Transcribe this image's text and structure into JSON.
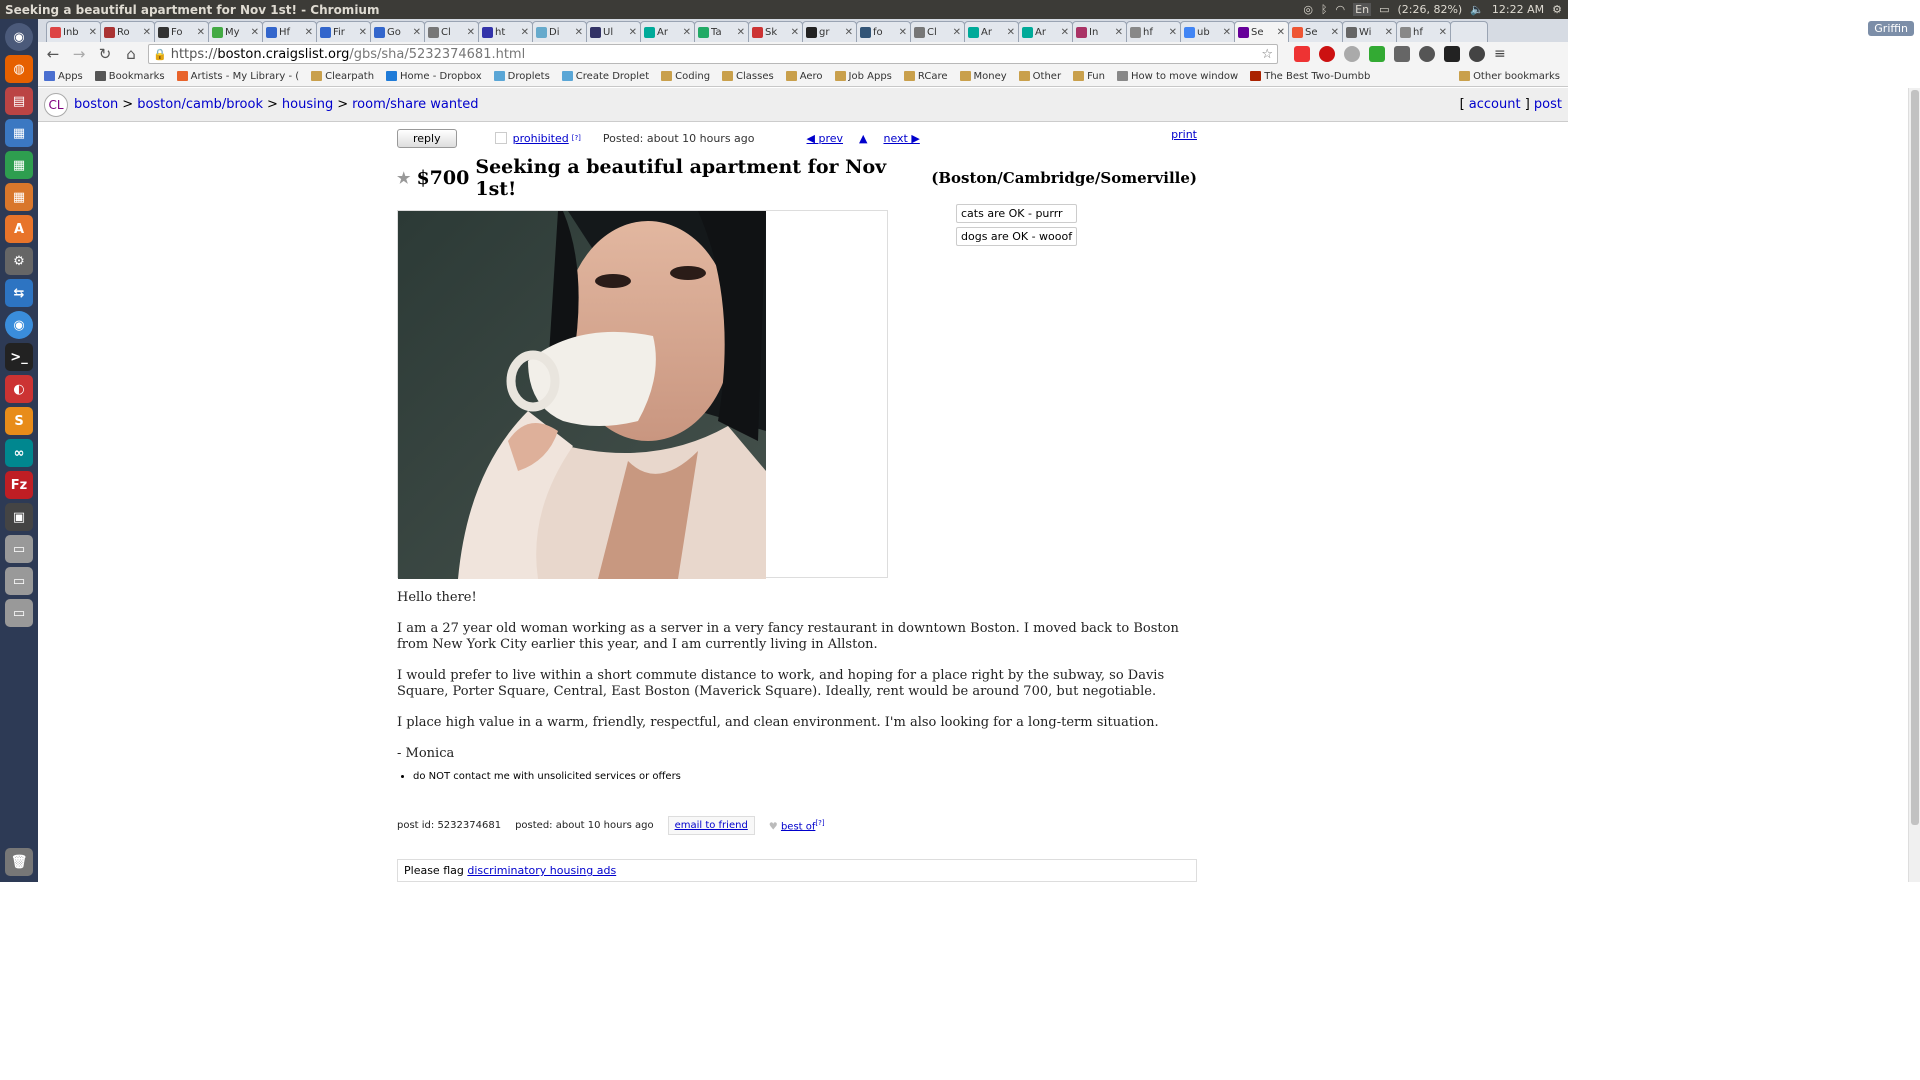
{
  "window": {
    "title": "Seeking a beautiful apartment for Nov 1st! - Chromium"
  },
  "tray": {
    "battery": "(2:26, 82%)",
    "time": "12:22 AM",
    "lang": "En"
  },
  "tabs": [
    {
      "label": "Inb",
      "color": "#d44"
    },
    {
      "label": "Ro",
      "color": "#a33"
    },
    {
      "label": "Fo",
      "color": "#333"
    },
    {
      "label": "My",
      "color": "#4a4"
    },
    {
      "label": "Hf",
      "color": "#36c"
    },
    {
      "label": "Fir",
      "color": "#36c"
    },
    {
      "label": "Go",
      "color": "#36c"
    },
    {
      "label": "Cl",
      "color": "#777"
    },
    {
      "label": "ht",
      "color": "#33a"
    },
    {
      "label": "Di",
      "color": "#6ac"
    },
    {
      "label": "Ul",
      "color": "#336"
    },
    {
      "label": "Ar",
      "color": "#0a9"
    },
    {
      "label": "Ta",
      "color": "#2a6"
    },
    {
      "label": "Sk",
      "color": "#c33"
    },
    {
      "label": "gr",
      "color": "#222"
    },
    {
      "label": "fo",
      "color": "#357"
    },
    {
      "label": "Cl",
      "color": "#777"
    },
    {
      "label": "Ar",
      "color": "#0a9"
    },
    {
      "label": "Ar",
      "color": "#0a9"
    },
    {
      "label": "In",
      "color": "#a36"
    },
    {
      "label": "hf",
      "color": "#888"
    },
    {
      "label": "ub",
      "color": "#4285f4"
    },
    {
      "label": "Se",
      "color": "#609"
    },
    {
      "label": "Se",
      "color": "#e53"
    },
    {
      "label": "Wi",
      "color": "#666"
    },
    {
      "label": "hf",
      "color": "#888"
    }
  ],
  "active_tab": 22,
  "profile": "Griffin",
  "address": {
    "scheme": "https://",
    "host": "boston.craigslist.org",
    "path": "/gbs/sha/5232374681.html"
  },
  "bookmarks": [
    {
      "label": "Apps",
      "color": "#4a6fd0"
    },
    {
      "label": "Bookmarks",
      "color": "#555"
    },
    {
      "label": "Artists - My Library - (",
      "color": "#e8632b"
    },
    {
      "label": "Clearpath",
      "color": "#c9a04c"
    },
    {
      "label": "Home - Dropbox",
      "color": "#1f7bd8"
    },
    {
      "label": "Droplets",
      "color": "#5aa6d6"
    },
    {
      "label": "Create Droplet",
      "color": "#5aa6d6"
    },
    {
      "label": "Coding",
      "color": "#c9a04c"
    },
    {
      "label": "Classes",
      "color": "#c9a04c"
    },
    {
      "label": "Aero",
      "color": "#c9a04c"
    },
    {
      "label": "Job Apps",
      "color": "#c9a04c"
    },
    {
      "label": "RCare",
      "color": "#c9a04c"
    },
    {
      "label": "Money",
      "color": "#c9a04c"
    },
    {
      "label": "Other",
      "color": "#c9a04c"
    },
    {
      "label": "Fun",
      "color": "#c9a04c"
    },
    {
      "label": "How to move window",
      "color": "#888"
    },
    {
      "label": "The Best Two-Dumbb",
      "color": "#a20"
    }
  ],
  "other_bookmarks": "Other bookmarks",
  "cl": {
    "logo": "CL",
    "breadcrumbs": [
      "boston",
      "boston/camb/brook",
      "housing",
      "room/share wanted"
    ],
    "account": "account",
    "post": "post"
  },
  "post": {
    "reply": "reply",
    "prohibited": "prohibited",
    "help_mark": "[?]",
    "posted_label": "Posted:",
    "posted_value": "about 10 hours ago",
    "prev": "◀ prev",
    "up": "▲",
    "next": "next ▶",
    "print": "print",
    "price": "$700",
    "title": "Seeking a beautiful apartment for Nov 1st!",
    "location": "(Boston/Cambridge/Somerville)",
    "attributes": [
      "cats are OK - purrr",
      "dogs are OK - wooof"
    ],
    "body": [
      "Hello there!",
      "I am a 27 year old woman working as a server in a very fancy restaurant in downtown Boston. I moved back to Boston from New York City earlier this year, and I am currently living in Allston.",
      "I would prefer to live within a short commute distance to work, and hoping for a place right by the subway, so Davis Square, Porter Square, Central, East Boston (Maverick Square). Ideally, rent would be around 700, but negotiable.",
      "I place high value in a warm, friendly, respectful, and clean environment. I'm also looking for a long-term situation.",
      "- Monica"
    ],
    "notice": "do NOT contact me with unsolicited services or offers",
    "post_id_label": "post id: 5232374681",
    "posted_footer_label": "posted:",
    "posted_footer_value": "about 10 hours ago",
    "email_friend": "email to friend",
    "best_of": "best of",
    "flag_text": "Please flag",
    "flag_link": "discriminatory housing ads"
  }
}
